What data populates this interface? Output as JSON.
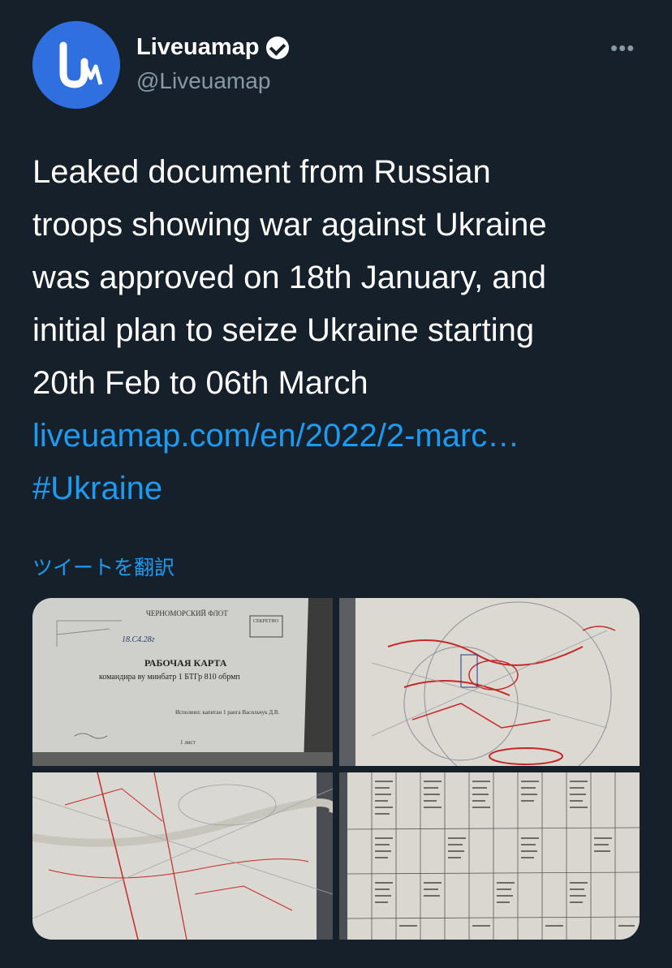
{
  "author": {
    "display_name": "Liveuamap",
    "handle": "@Liveuamap",
    "verified": true,
    "avatar_icon": "liveuamap-logo-icon"
  },
  "menu": {
    "more_label": "•••"
  },
  "tweet": {
    "lines": [
      "Leaked document from Russian",
      "troops showing war against Ukraine",
      "was approved on 18th January, and",
      "initial plan to seize Ukraine starting",
      "20th Feb to 06th March"
    ],
    "link": "liveuamap.com/en/2022/2-marc…",
    "hashtag": "#Ukraine",
    "translate_label": "ツイートを翻訳"
  },
  "media": {
    "doc": {
      "header": "ЧЕРНОМОРСКИЙ ФЛОТ",
      "stamp1": "СЕКРЕТНО",
      "handwritten": "18.С4.28г",
      "title": "РАБОЧАЯ КАРТА",
      "subtitle": "командира ву минбатр 1 БТГр 810 обрмп",
      "signature_line": "Исполнил: капитан 1 ранга Васильчук Д.В.",
      "sheet": "1 лист"
    }
  },
  "colors": {
    "background": "#15202b",
    "text": "#ffffff",
    "secondary": "#8899a6",
    "accent": "#1d9bf0",
    "avatar": "#2f6fe0"
  }
}
